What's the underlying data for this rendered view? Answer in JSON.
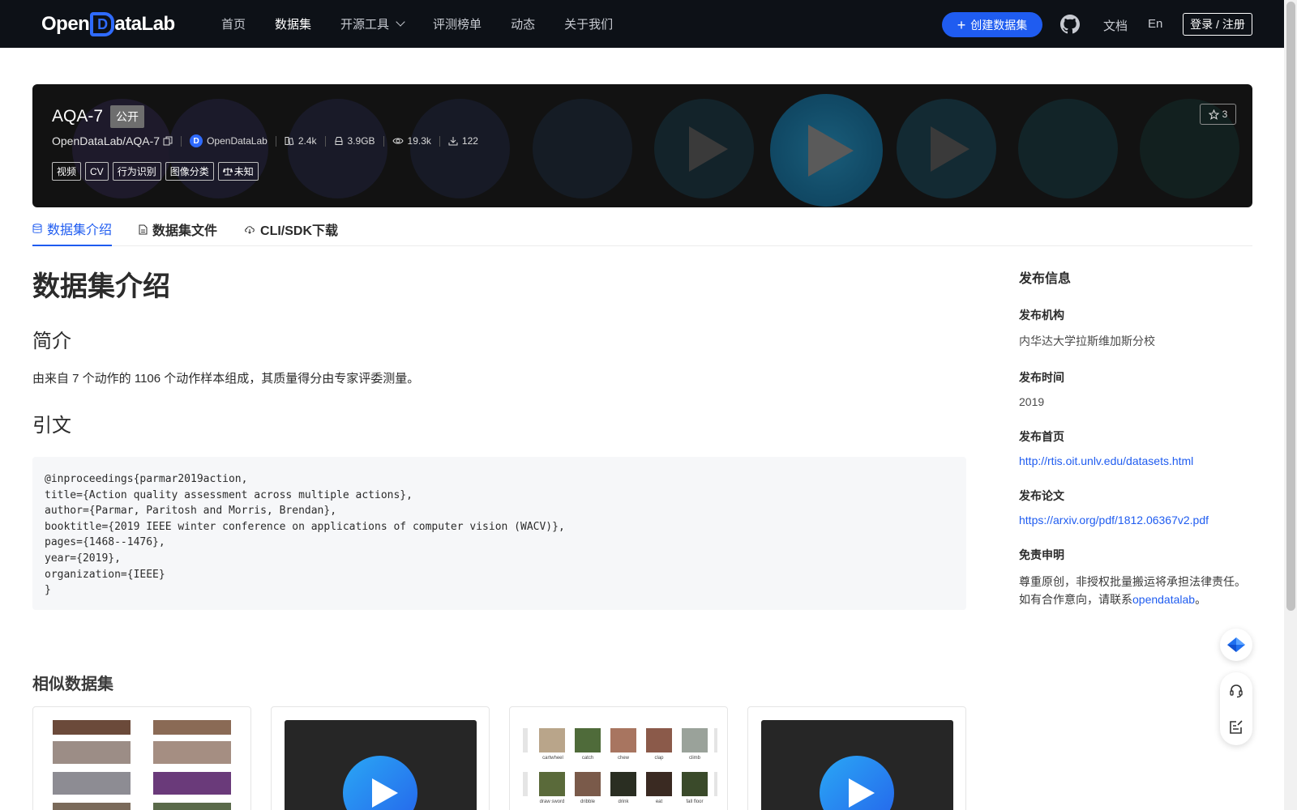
{
  "header": {
    "logo_text_1": "Open",
    "logo_text_2": "ataLab",
    "logo_mark": "D",
    "nav": [
      {
        "label": "首页"
      },
      {
        "label": "数据集"
      },
      {
        "label": "开源工具"
      },
      {
        "label": "评测榜单"
      },
      {
        "label": "动态"
      },
      {
        "label": "关于我们"
      }
    ],
    "create_label": "创建数据集",
    "docs_label": "文档",
    "lang_label": "En",
    "login_label": "登录 / 注册"
  },
  "banner": {
    "title": "AQA-7",
    "visibility": "公开",
    "path": "OpenDataLab/AQA-7",
    "org": "OpenDataLab",
    "files": "2.4k",
    "size": "3.9GB",
    "views": "19.3k",
    "downloads": "122",
    "tags": [
      "视频",
      "CV",
      "行为识别",
      "图像分类"
    ],
    "license": "未知",
    "stars": "3"
  },
  "tabs": [
    {
      "label": "数据集介绍",
      "icon": "database-icon"
    },
    {
      "label": "数据集文件",
      "icon": "file-icon"
    },
    {
      "label": "CLI/SDK下载",
      "icon": "cloud-download-icon"
    }
  ],
  "content": {
    "heading": "数据集介绍",
    "intro_heading": "简介",
    "intro_text": "由来自 7 个动作的 1106 个动作样本组成，其质量得分由专家评委测量。",
    "citation_heading": "引文",
    "citation": "@inproceedings{parmar2019action,\ntitle={Action quality assessment across multiple actions},\nauthor={Parmar, Paritosh and Morris, Brendan},\nbooktitle={2019 IEEE winter conference on applications of computer vision (WACV)},\npages={1468--1476},\nyear={2019},\norganization={IEEE}\n}",
    "similar_heading": "相似数据集"
  },
  "sidebar": {
    "title": "发布信息",
    "publisher_label": "发布机构",
    "publisher": "内华达大学拉斯维加斯分校",
    "year_label": "发布时间",
    "year": "2019",
    "homepage_label": "发布首页",
    "homepage": "http://rtis.oit.unlv.edu/datasets.html",
    "paper_label": "发布论文",
    "paper": "https://arxiv.org/pdf/1812.06367v2.pdf",
    "disclaimer_label": "免责申明",
    "disclaimer_1": "尊重原创，非授权批量搬运将承担法律责任。",
    "disclaimer_2": "如有合作意向，请联系",
    "disclaimer_link": "opendatalab",
    "disclaimer_end": "。"
  },
  "cards": {
    "card3_labels": [
      "cartwheel",
      "catch",
      "chew",
      "clap",
      "climb",
      "draw sword",
      "dribble",
      "drink",
      "eat",
      "fall floor"
    ]
  },
  "colors": {
    "brand": "#1f5cf0",
    "header_bg": "#0d1117",
    "banner_bg": "#121212"
  }
}
